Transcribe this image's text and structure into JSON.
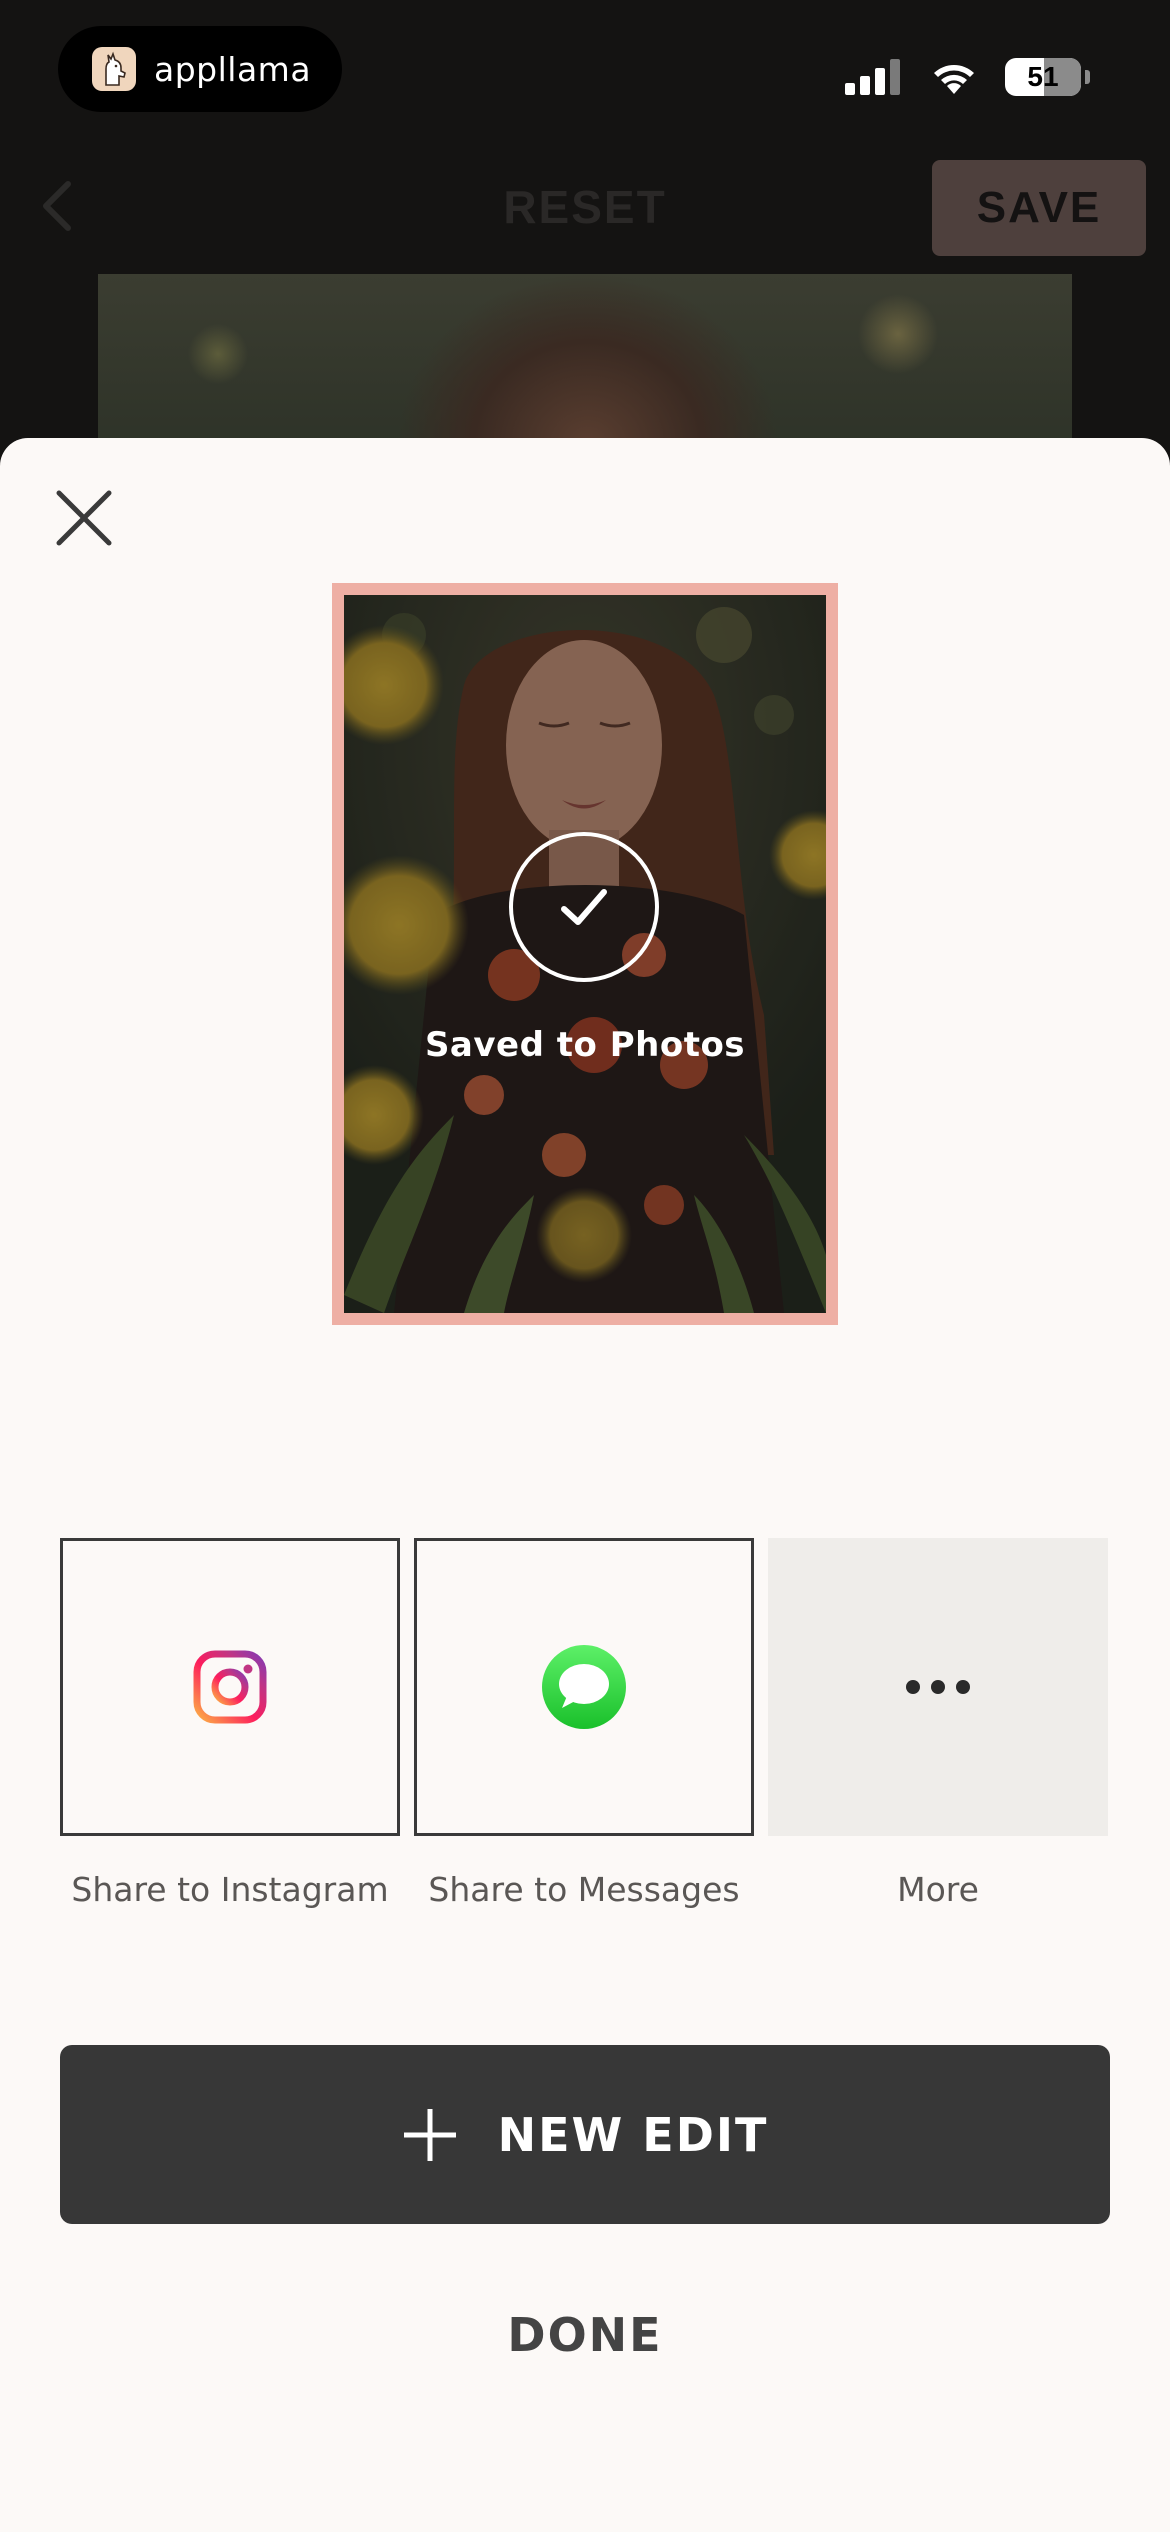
{
  "status_bar": {
    "app_name": "appllama",
    "battery_level": "51"
  },
  "editor": {
    "reset_label": "RESET",
    "save_label": "SAVE"
  },
  "sheet": {
    "saved_label": "Saved to Photos",
    "share_options": [
      {
        "label": "Share to Instagram",
        "icon": "instagram-icon"
      },
      {
        "label": "Share to Messages",
        "icon": "messages-icon"
      },
      {
        "label": "More",
        "icon": "more-icon"
      }
    ],
    "new_edit_label": "NEW EDIT",
    "done_label": "DONE"
  },
  "colors": {
    "sheet_background": "#fcf9f7",
    "preview_border": "#eeafa4",
    "primary_button": "#373737",
    "save_button_dimmed": "#4e403d"
  }
}
